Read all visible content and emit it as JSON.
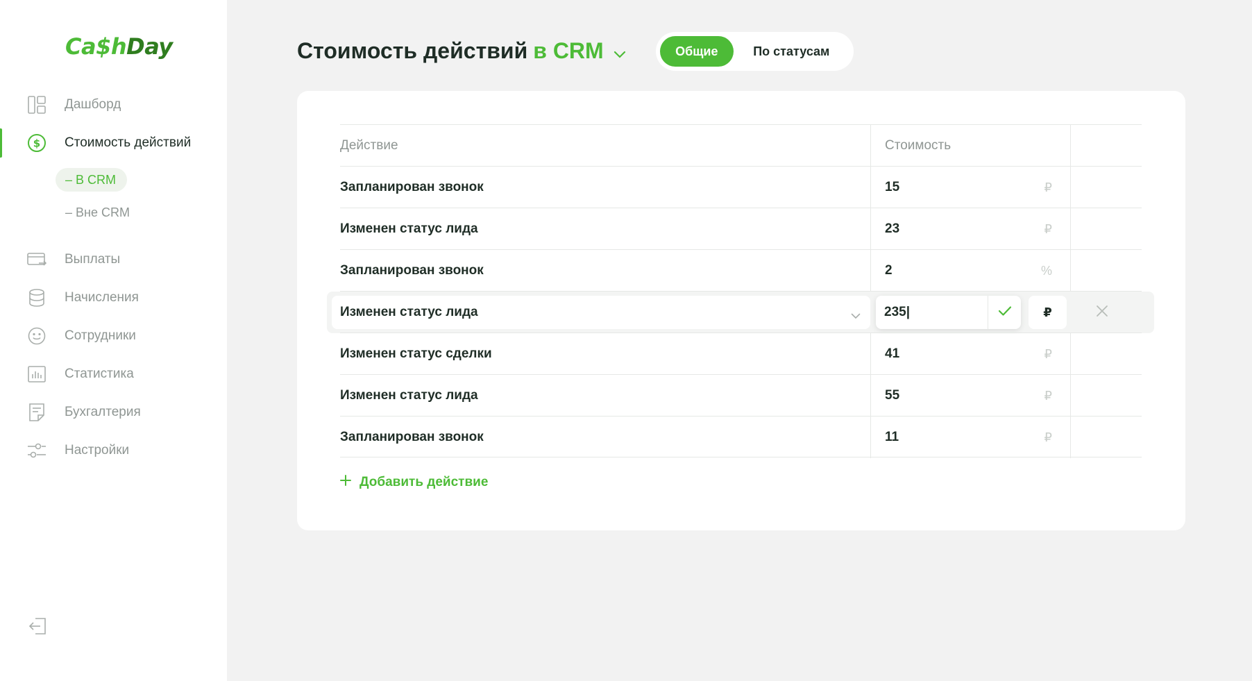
{
  "logo": {
    "part1": "Ca$h",
    "part2": "Day"
  },
  "sidebar": {
    "items": [
      {
        "label": "Дашборд",
        "icon": "dashboard-icon"
      },
      {
        "label": "Стоимость действий",
        "icon": "dollar-circle-icon",
        "active": true
      },
      {
        "label": "Выплаты",
        "icon": "card-transfer-icon"
      },
      {
        "label": "Начисления",
        "icon": "database-icon"
      },
      {
        "label": "Сотрудники",
        "icon": "smile-icon"
      },
      {
        "label": "Статистика",
        "icon": "chart-icon"
      },
      {
        "label": "Бухгалтерия",
        "icon": "document-icon"
      },
      {
        "label": "Настройки",
        "icon": "sliders-icon"
      }
    ],
    "subitems": [
      {
        "label": "– В CRM",
        "active": true
      },
      {
        "label": "– Вне CRM",
        "active": false
      }
    ],
    "logout_icon": "logout-icon"
  },
  "header": {
    "title": "Стоимость действий",
    "title_accent": "в CRM",
    "toggle": {
      "on": "Общие",
      "off": "По статусам"
    }
  },
  "colors": {
    "accent": "#4dbb37",
    "text": "#1f2d26",
    "muted": "#8f9693"
  },
  "table": {
    "columns": [
      "Действие",
      "Стоимость"
    ],
    "rows": [
      {
        "action": "Запланирован звонок",
        "cost": "15",
        "unit": "₽"
      },
      {
        "action": "Изменен статус лида",
        "cost": "23",
        "unit": "₽"
      },
      {
        "action": "Запланирован звонок",
        "cost": "2",
        "unit": "%"
      },
      {
        "action": "Изменен статус лида",
        "cost": "235|",
        "unit": "₽",
        "editing": true
      },
      {
        "action": "Изменен статус сделки",
        "cost": "41",
        "unit": "₽"
      },
      {
        "action": "Изменен статус лида",
        "cost": "55",
        "unit": "₽"
      },
      {
        "action": "Запланирован звонок",
        "cost": "11",
        "unit": "₽"
      }
    ]
  },
  "add_action_label": "Добавить действие"
}
